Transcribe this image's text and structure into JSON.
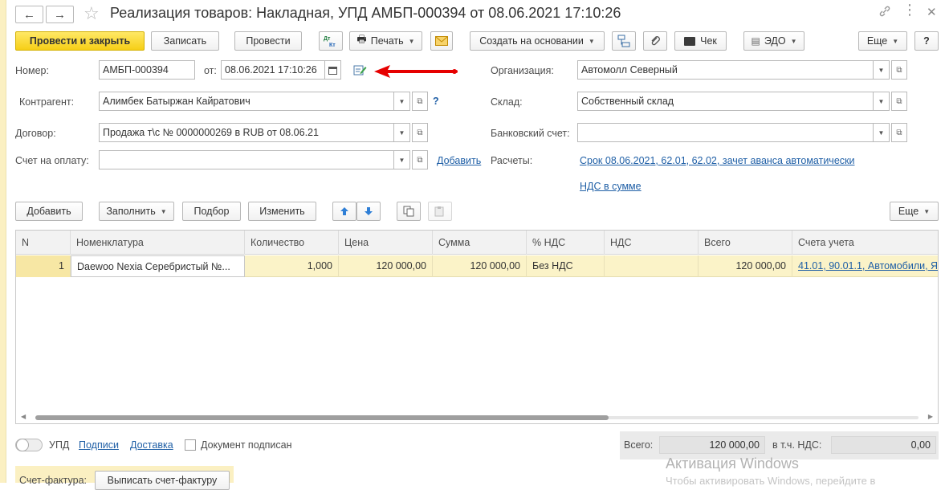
{
  "window": {
    "title": "Реализация товаров: Накладная, УПД АМБП-000394 от 08.06.2021 17:10:26",
    "back_icon": "←",
    "forward_icon": "→"
  },
  "toolbar": {
    "post_close": "Провести и закрыть",
    "save": "Записать",
    "post": "Провести",
    "dt_kt": "Дт Кт",
    "print": "Печать",
    "create_based": "Создать на основании",
    "check": "Чек",
    "edo": "ЭДО",
    "more": "Еще",
    "help": "?"
  },
  "form": {
    "number_label": "Номер:",
    "number_value": "АМБП-000394",
    "date_label": "от:",
    "date_value": "08.06.2021 17:10:26",
    "org_label": "Организация:",
    "org_value": "Автомолл Северный",
    "contractor_label": "Контрагент:",
    "contractor_value": "Алимбек Батыржан Кайратович",
    "contractor_help": "?",
    "warehouse_label": "Склад:",
    "warehouse_value": "Собственный склад",
    "contract_label": "Договор:",
    "contract_value": "Продажа т\\с № 0000000269 в RUB от 08.06.21",
    "bank_label": "Банковский счет:",
    "bank_value": "",
    "invoice_label": "Счет на оплату:",
    "invoice_value": "",
    "invoice_add": "Добавить",
    "calc_label": "Расчеты:",
    "calc_link": "Срок 08.06.2021, 62.01, 62.02, зачет аванса автоматически",
    "vat_link": "НДС в сумме"
  },
  "table_toolbar": {
    "add": "Добавить",
    "fill": "Заполнить",
    "select": "Подбор",
    "edit": "Изменить",
    "more": "Еще"
  },
  "table": {
    "columns": [
      "N",
      "Номенклатура",
      "Количество",
      "Цена",
      "Сумма",
      "% НДС",
      "НДС",
      "Всего",
      "Счета учета"
    ],
    "rows": [
      {
        "n": "1",
        "item": "Daewoo Nexia Серебристый №...",
        "qty": "1,000",
        "price": "120 000,00",
        "sum": "120 000,00",
        "vat_rate": "Без НДС",
        "vat": "",
        "total": "120 000,00",
        "accounts": "41.01, 90.01.1, Автомобили, Я..."
      }
    ]
  },
  "footer": {
    "upd_label": "УПД",
    "signatures_link": "Подписи",
    "delivery_link": "Доставка",
    "signed_label": "Документ подписан",
    "total_label": "Всего:",
    "total_value": "120 000,00",
    "vat_label": "в т.ч. НДС:",
    "vat_value": "0,00",
    "invoice_label": "Счет-фактура:",
    "invoice_button": "Выписать счет-фактуру"
  },
  "watermark": {
    "line1": "Активация Windows",
    "line2": "Чтобы активировать Windows, перейдите в"
  },
  "colors": {
    "primary_button": "#f6cf17",
    "selected_row": "#fbf3c8",
    "link": "#1f5fa6",
    "annotation_arrow": "#e60000"
  }
}
